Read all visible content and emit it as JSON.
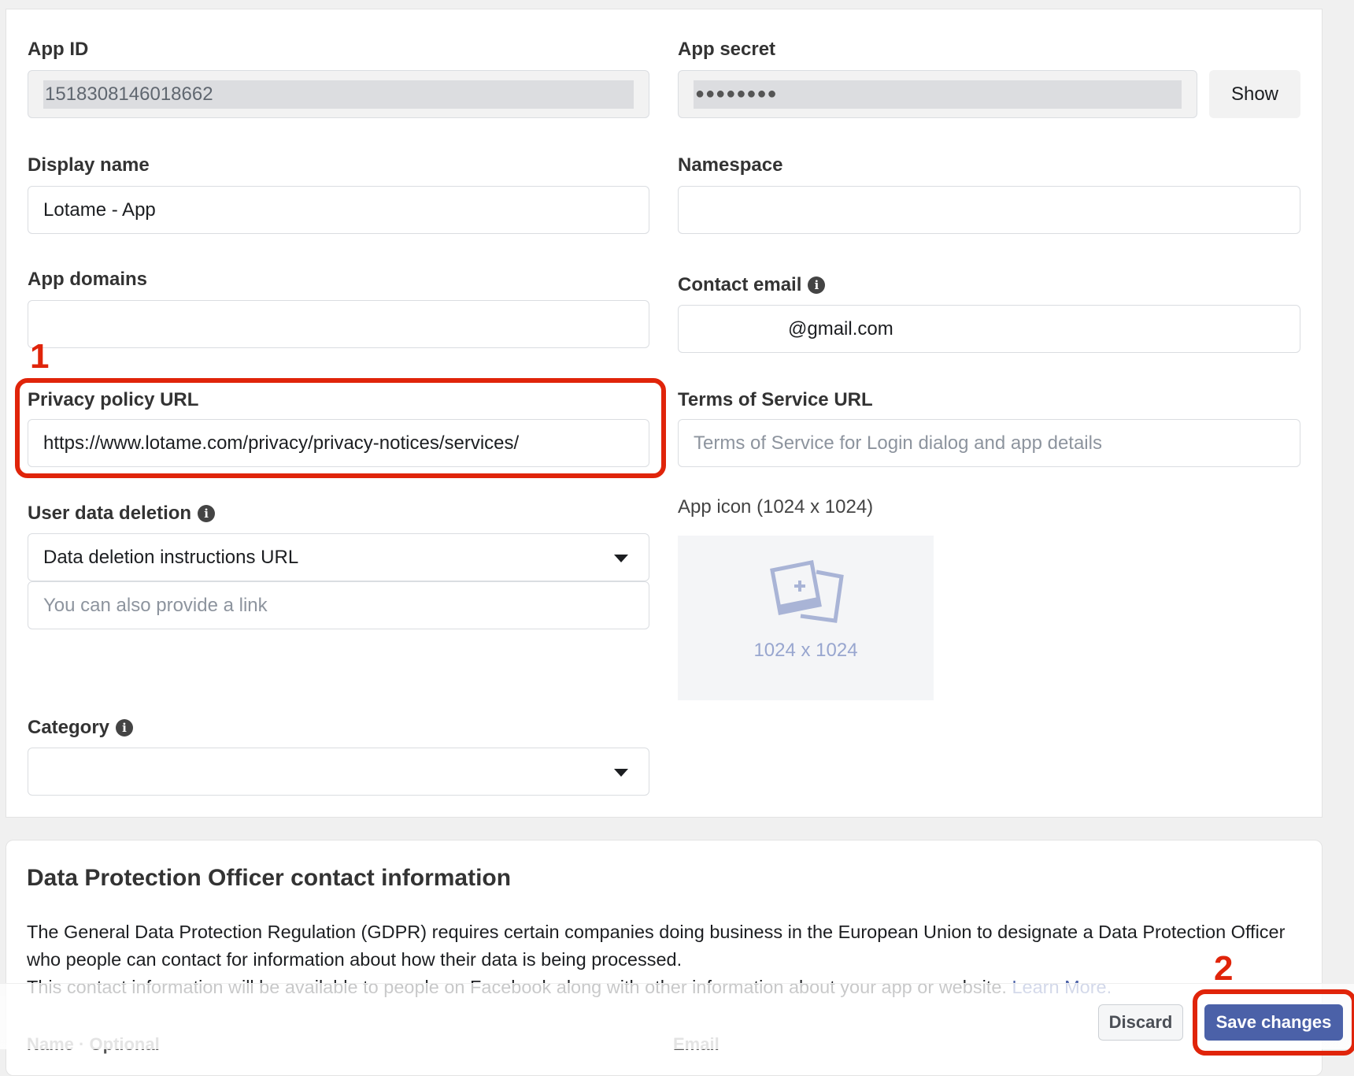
{
  "fields": {
    "app_id": {
      "label": "App ID",
      "value": "1518308146018662"
    },
    "app_secret": {
      "label": "App secret",
      "value": "●●●●●●●●",
      "show_label": "Show"
    },
    "display_name": {
      "label": "Display name",
      "value": "Lotame - App"
    },
    "namespace": {
      "label": "Namespace",
      "value": ""
    },
    "app_domains": {
      "label": "App domains",
      "value": ""
    },
    "contact_email": {
      "label": "Contact email",
      "value": "@gmail.com"
    },
    "privacy_policy": {
      "label": "Privacy policy URL",
      "value": "https://www.lotame.com/privacy/privacy-notices/services/"
    },
    "terms": {
      "label": "Terms of Service URL",
      "placeholder": "Terms of Service for Login dialog and app details"
    },
    "user_data_deletion": {
      "label": "User data deletion",
      "selected": "Data deletion instructions URL",
      "link_placeholder": "You can also provide a link"
    },
    "app_icon": {
      "label": "App icon (1024 x 1024)",
      "size_text": "1024 x 1024"
    },
    "category": {
      "label": "Category",
      "selected": ""
    }
  },
  "annotations": {
    "step1": "1",
    "step2": "2"
  },
  "dpo": {
    "title": "Data Protection Officer contact information",
    "paragraph1": "The General Data Protection Regulation (GDPR) requires certain companies doing business in the European Union to designate a Data Protection Officer who people can contact for information about how their data is being processed.",
    "paragraph2": "This contact information will be available to people on Facebook along with other information about your app or website.",
    "learn_more": "Learn More.",
    "name_label": "Name · Optional",
    "email_label": "Email"
  },
  "footer": {
    "discard": "Discard",
    "save": "Save changes"
  },
  "colors": {
    "accent": "#4b61a8",
    "annotation": "#e0240a"
  }
}
